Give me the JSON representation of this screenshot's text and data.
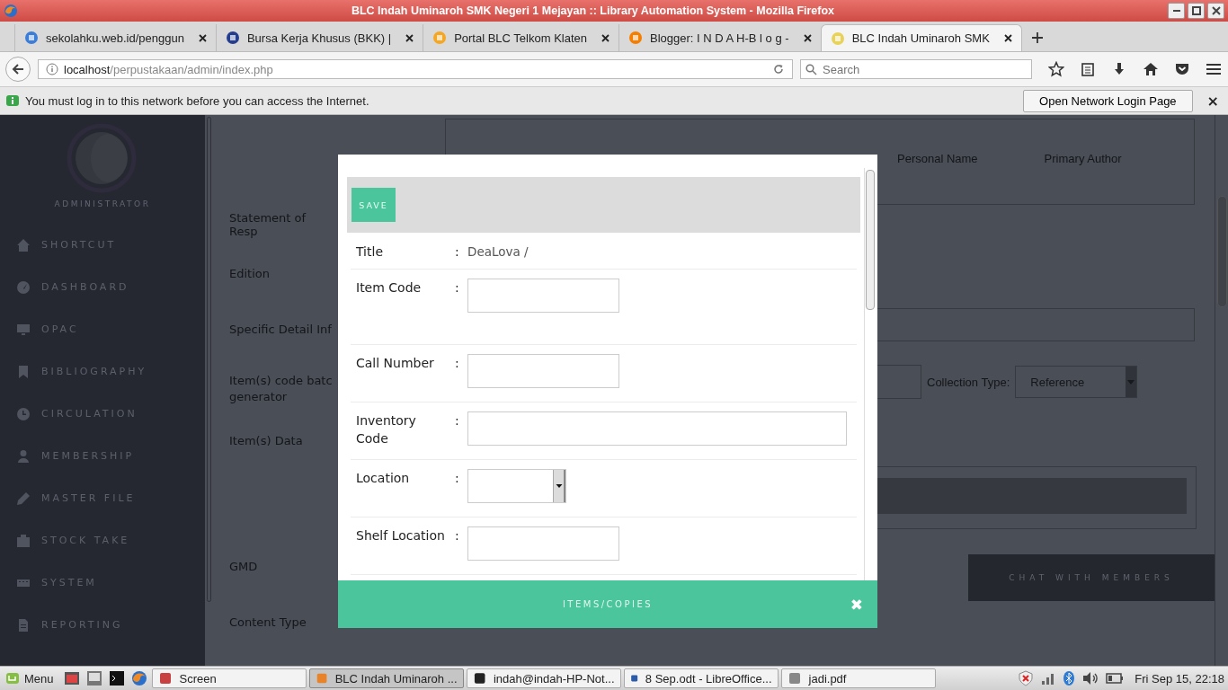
{
  "window": {
    "title": "BLC Indah Uminaroh SMK Negeri 1 Mejayan :: Library Automation System - Mozilla Firefox"
  },
  "tabs": [
    {
      "label": "sekolahku.web.id/penggun",
      "selected": false
    },
    {
      "label": "Bursa Kerja Khusus (BKK) |",
      "selected": false
    },
    {
      "label": "Portal BLC Telkom Klaten",
      "selected": false
    },
    {
      "label": "Blogger: I N D A H-B l o g -",
      "selected": false
    },
    {
      "label": "BLC Indah Uminaroh SMK",
      "selected": true
    }
  ],
  "address": {
    "host": "localhost",
    "path": "/perpustakaan/admin/index.php"
  },
  "search": {
    "placeholder": "Search"
  },
  "notification": {
    "message": "You must log in to this network before you can access the Internet.",
    "button": "Open Network Login Page",
    "close": "×"
  },
  "sidebar": {
    "role": "ADMINISTRATOR",
    "items": [
      {
        "label": "SHORTCUT"
      },
      {
        "label": "DASHBOARD"
      },
      {
        "label": "OPAC"
      },
      {
        "label": "BIBLIOGRAPHY"
      },
      {
        "label": "CIRCULATION"
      },
      {
        "label": "MEMBERSHIP"
      },
      {
        "label": "MASTER FILE"
      },
      {
        "label": "STOCK TAKE"
      },
      {
        "label": "SYSTEM"
      },
      {
        "label": "REPORTING"
      }
    ]
  },
  "background_form": {
    "columns": [
      "Personal Name",
      "Primary Author"
    ],
    "labels": [
      "Statement of Resp",
      "Edition",
      "Specific Detail Inf",
      "Item(s) code batc generator",
      "Item(s) Data",
      "GMD",
      "Content Type"
    ],
    "collection_type_label": "Collection Type:",
    "collection_type_value": "Reference",
    "chat_button": "CHAT WITH MEMBERS"
  },
  "modal": {
    "save": "SAVE",
    "footer": "ITEMS/COPIES",
    "close": "✖",
    "rows": [
      {
        "label": "Title",
        "colon": ":",
        "kind": "text",
        "value": "DeaLova /"
      },
      {
        "label": "Item Code",
        "colon": ":",
        "kind": "input"
      },
      {
        "label": "Call Number",
        "colon": ":",
        "kind": "input"
      },
      {
        "label": "Inventory Code",
        "colon": ":",
        "kind": "wide_input"
      },
      {
        "label": "Location",
        "colon": ":",
        "kind": "select"
      },
      {
        "label": "Shelf Location",
        "colon": ":",
        "kind": "input"
      }
    ]
  },
  "taskbar": {
    "menu": "Menu",
    "windows": [
      {
        "label": "Screen",
        "selected": false
      },
      {
        "label": "BLC Indah Uminaroh ...",
        "selected": true
      },
      {
        "label": "indah@indah-HP-Not...",
        "selected": false
      },
      {
        "label": "8 Sep.odt - LibreOffice...",
        "selected": false
      },
      {
        "label": "jadi.pdf",
        "selected": false
      }
    ],
    "clock": "Fri Sep 15, 22:18"
  }
}
